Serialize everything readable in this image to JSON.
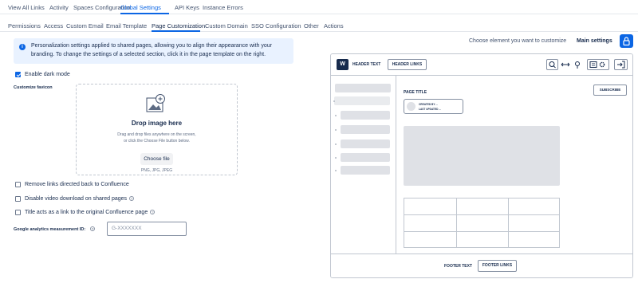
{
  "top_nav": {
    "tabs": [
      {
        "label": "View All Links"
      },
      {
        "label": "Activity"
      },
      {
        "label": "Spaces Configuration"
      },
      {
        "label": "Global Settings",
        "active": true
      },
      {
        "label": "API Keys"
      },
      {
        "label": "Instance Errors"
      }
    ]
  },
  "sub_nav": {
    "tabs": [
      {
        "label": "Permissions"
      },
      {
        "label": "Access"
      },
      {
        "label": "Custom Email"
      },
      {
        "label": "Email Template"
      },
      {
        "label": "Page Customization",
        "active": true
      },
      {
        "label": "Custom Domain"
      },
      {
        "label": "SSO Configuration"
      },
      {
        "label": "Other"
      },
      {
        "label": "Actions"
      }
    ]
  },
  "info": {
    "line1": "Personalization settings applied to shared pages, allowing you to align their appearance with your",
    "line2": "branding. To change the settings of a selected section, click it in the page template on the right."
  },
  "dark_mode": {
    "label": "Enable dark mode",
    "checked": true
  },
  "favicon": {
    "label": "Customize favicon",
    "drop_title": "Drop image here",
    "drop_desc1": "Drag and drop files anywhere on the screen,",
    "drop_desc2": "or click the Choose File button below.",
    "choose_button": "Choose file",
    "file_types": "PNG, JPG, JPEG"
  },
  "options": [
    {
      "label": "Remove links directed back to Confluence",
      "checked": false,
      "help": false
    },
    {
      "label": "Disable video download on shared pages",
      "checked": false,
      "help": true
    },
    {
      "label": "Title acts as a link to the original Confluence page",
      "checked": false,
      "help": true
    }
  ],
  "analytics": {
    "label": "Google analytics measurement ID:",
    "placeholder": "G-XXXXXXX"
  },
  "right_panel": {
    "hint": "Choose element you want to customize",
    "main_settings": "Main settings"
  },
  "preview": {
    "header_text": "HEADER TEXT",
    "header_links": "HEADER LINKS",
    "page_title": "PAGE TITLE",
    "subscribe": "SUBSCRIBE",
    "created_by": "CREATED BY ...",
    "last_updated": "LAST UPDATED ...",
    "footer_text": "FOOTER TEXT",
    "footer_links": "FOOTER LINKS"
  },
  "colors": {
    "accent": "#0c66e4",
    "info_bg": "#e9f2ff",
    "placeholder_block": "#dfe1e6"
  }
}
